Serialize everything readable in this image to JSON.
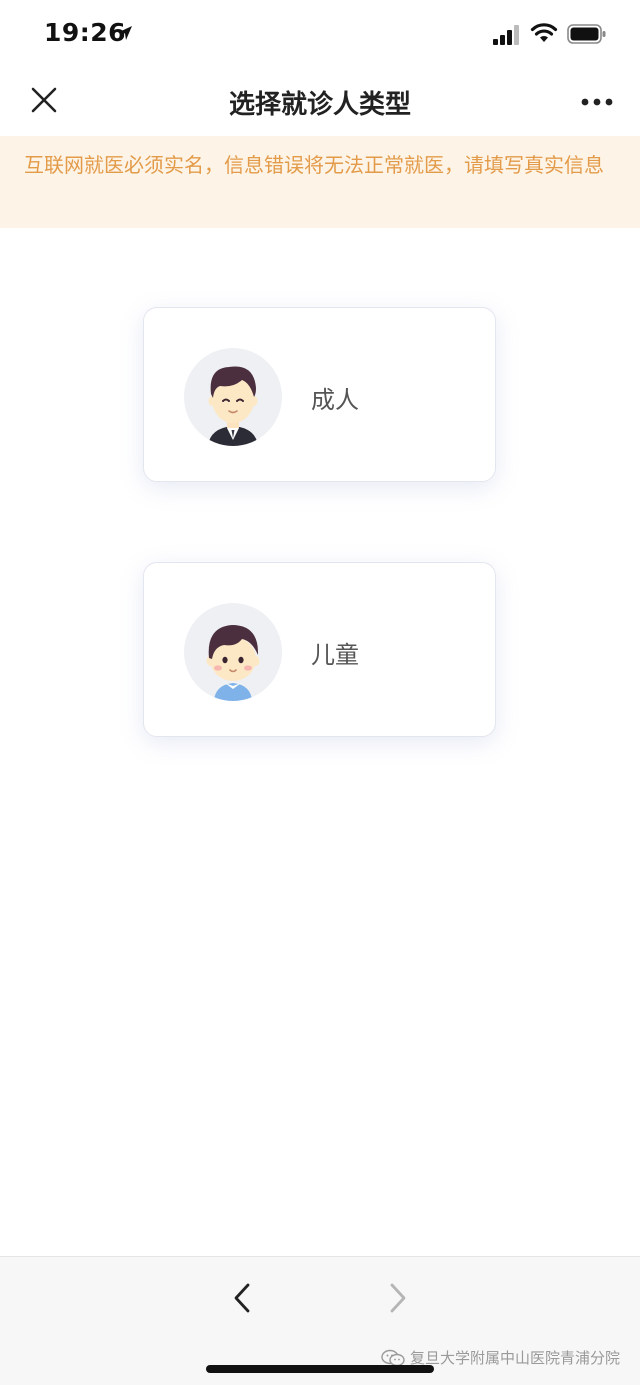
{
  "status_bar": {
    "time": "19:26"
  },
  "nav": {
    "title": "选择就诊人类型"
  },
  "notice": {
    "text": "互联网就医必须实名，信息错误将无法正常就医，请填写真实信息"
  },
  "patient_types": [
    {
      "label": "成人",
      "avatar": "adult-avatar-icon"
    },
    {
      "label": "儿童",
      "avatar": "child-avatar-icon"
    }
  ],
  "toolbar": {
    "watermark": "复旦大学附属中山医院青浦分院"
  },
  "colors": {
    "notice_bg": "#fdf4e7",
    "notice_text": "#e39b4a"
  }
}
